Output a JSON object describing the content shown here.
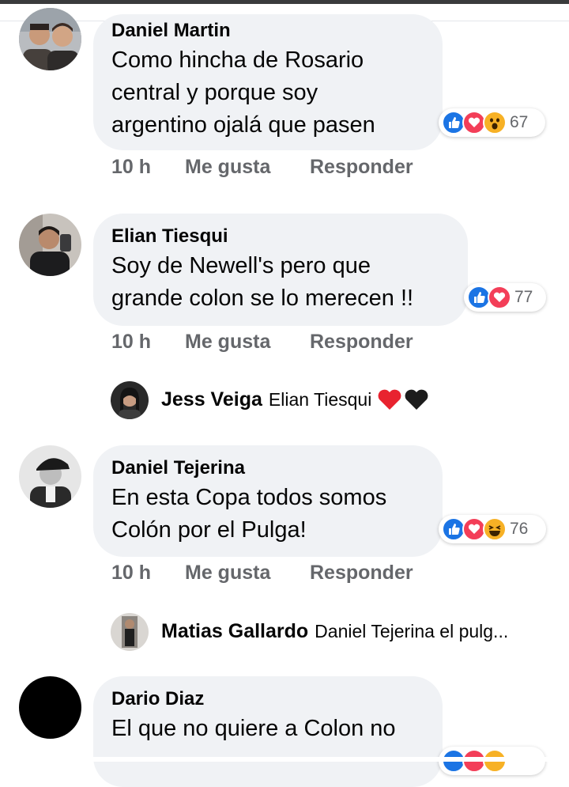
{
  "comments": [
    {
      "author": "Daniel Martin",
      "lines": [
        "Como hincha de Rosario",
        "central y porque soy",
        "argentino ojalá que pasen"
      ],
      "reaction_count": "67",
      "reactions": [
        "like-icon",
        "love-icon",
        "wow-icon"
      ],
      "time": "10 h",
      "like_label": "Me gusta",
      "reply_label": "Responder"
    },
    {
      "author": "Elian Tiesqui",
      "lines": [
        "Soy de Newell's pero que",
        "grande colon se lo merecen !!"
      ],
      "reaction_count": "77",
      "reactions": [
        "like-icon",
        "love-icon"
      ],
      "time": "10 h",
      "like_label": "Me gusta",
      "reply_label": "Responder",
      "reply": {
        "author": "Jess Veiga",
        "text": "Elian Tiesqui",
        "emojis": [
          "red-heart-icon",
          "black-heart-icon"
        ]
      }
    },
    {
      "author": "Daniel Tejerina",
      "lines": [
        "En esta Copa todos somos",
        "Colón por el Pulga!"
      ],
      "reaction_count": "76",
      "reactions": [
        "like-icon",
        "love-icon",
        "haha-icon"
      ],
      "time": "10 h",
      "like_label": "Me gusta",
      "reply_label": "Responder",
      "reply": {
        "author": "Matias Gallardo",
        "text": "Daniel Tejerina el pulg..."
      }
    },
    {
      "author": "Dario Diaz",
      "lines": [
        "El que no quiere a Colon no"
      ]
    }
  ],
  "colors": {
    "bubble": "#f0f2f5",
    "like": "#1b74e4",
    "love": "#f33e58",
    "wow": "#f7b125",
    "meta_text": "#65676b"
  }
}
